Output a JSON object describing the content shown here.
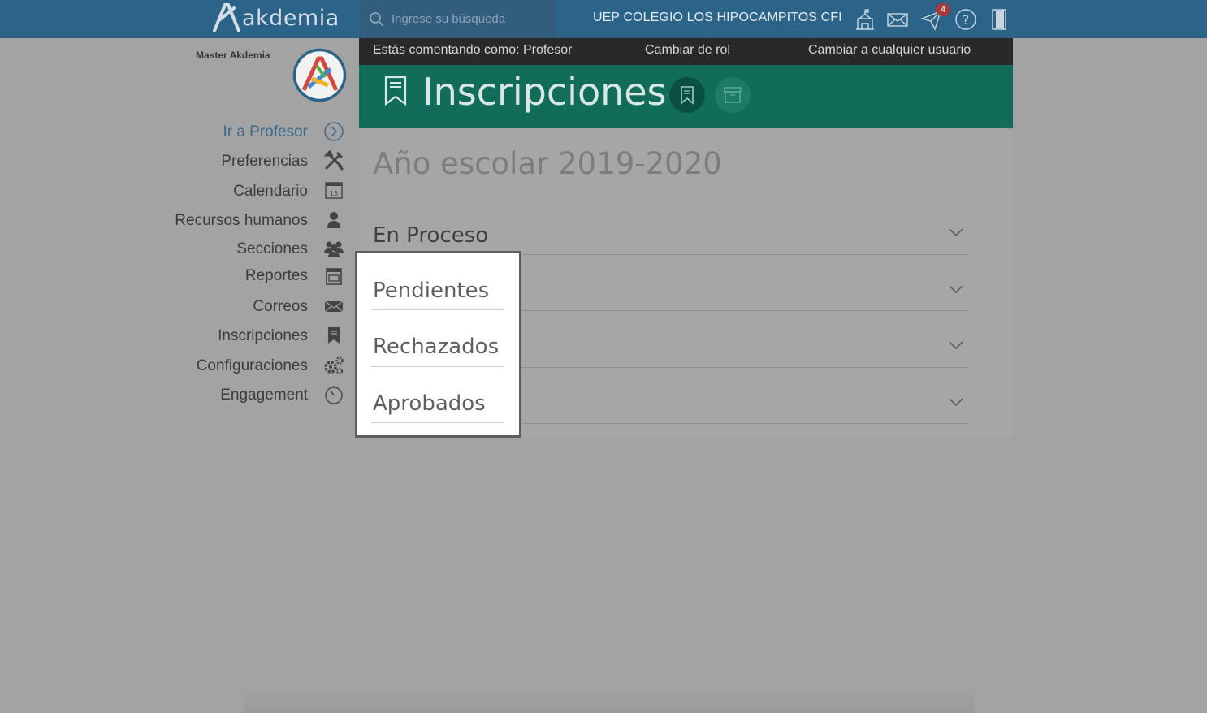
{
  "brand": {
    "name": "akdemia"
  },
  "search": {
    "placeholder": "Ingrese su búsqueda"
  },
  "header": {
    "school": "UEP COLEGIO LOS HIPOCAMPITOS CFI",
    "notifications_count": "4",
    "icons": [
      "school-icon",
      "mail-icon",
      "send-icon",
      "help-icon",
      "logout-icon"
    ]
  },
  "user": {
    "name": "Master Akdemia"
  },
  "sidebar": {
    "items": [
      {
        "label": "Ir a Profesor",
        "icon": "chevron-right-circle-icon",
        "active": true
      },
      {
        "label": "Preferencias",
        "icon": "tools-icon"
      },
      {
        "label": "Calendario",
        "icon": "calendar-icon"
      },
      {
        "label": "Recursos humanos",
        "icon": "person-icon"
      },
      {
        "label": "Secciones",
        "icon": "group-icon"
      },
      {
        "label": "Reportes",
        "icon": "report-icon"
      },
      {
        "label": "Correos",
        "icon": "envelope-icon"
      },
      {
        "label": "Inscripciones",
        "icon": "bookmark-icon"
      },
      {
        "label": "Configuraciones",
        "icon": "gears-icon"
      },
      {
        "label": "Engagement",
        "icon": "timer-icon"
      }
    ],
    "calendar_day": "15"
  },
  "rolebar": {
    "commenting_as": "Estás comentando como: Profesor",
    "change_role": "Cambiar de rol",
    "change_user": "Cambiar a cualquier usuario"
  },
  "page": {
    "title": "Inscripciones",
    "year": "Año escolar 2019-2020",
    "sections": [
      "En Proceso",
      "Pendientes",
      "Rechazados",
      "Aprobados"
    ]
  },
  "colors": {
    "topbar": "#2c6489",
    "banner": "#116c5a",
    "active_link": "#3d6a8a",
    "badge": "#a43b3b"
  }
}
